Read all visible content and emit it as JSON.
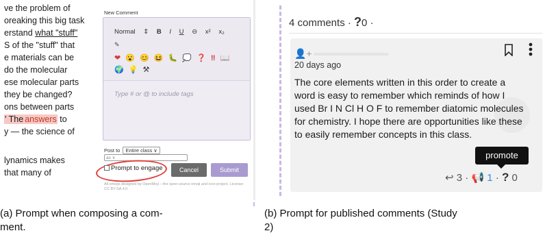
{
  "panel_a": {
    "article_lines": [
      "ve the problem of",
      "oreaking this big task",
      "erstand",
      "what \"stuff\"",
      "S of the \"stuff\" that",
      "e materials can be",
      "do the molecular",
      "ese molecular parts",
      "they be changed?",
      "ons between parts",
      "' The",
      "answers",
      "to",
      "y — the science of",
      "lynamics makes",
      " that many of"
    ],
    "editor": {
      "title": "New Comment",
      "toolbar": [
        "Normal",
        "⇕",
        "B",
        "I",
        "U",
        "⊖",
        "x²",
        "x₂"
      ],
      "link_icon": "✎",
      "emojis": [
        "❤",
        "😮",
        "😊",
        "😆",
        "🐛",
        "💭",
        "❓",
        "‼",
        "📖",
        "🌍",
        "💡",
        "⚒"
      ],
      "placeholder": "Type # or @ to include tags",
      "post_to_label": "Post to",
      "post_to_value": "Entire class ∨",
      "second_select": "as ∨",
      "prompt_label": "Prompt to engage",
      "cancel_label": "Cancel",
      "submit_label": "Submit",
      "attribution": "All emojis designed by OpenMoji – the open-source emoji and icon project. License: CC BY-SA 4.0"
    }
  },
  "panel_b": {
    "header": {
      "comments": "4 comments",
      "sep1": "·",
      "q_icon": "?",
      "q_count": "0",
      "sep2": "·"
    },
    "card": {
      "avatar": "👤+",
      "date": "20 days ago",
      "body": "The core elements written in this order to create a word is easy to remember which reminds of how I used Br I N Cl H O F to remember diatomic molecules for chemistry. I hope there are opportunities like these to easily remember concepts in this class.",
      "tooltip": "promote",
      "reply_icon": "↩",
      "reply_count": "3",
      "promote_icon": "📢",
      "promote_count": "1",
      "q_icon": "?",
      "q_count": "0",
      "sep": "·"
    }
  },
  "captions": {
    "a_line1": "(a) Prompt when composing a com-",
    "a_line2": "ment.",
    "b_line1": "(b) Prompt for published comments (Study",
    "b_line2": "2)"
  }
}
